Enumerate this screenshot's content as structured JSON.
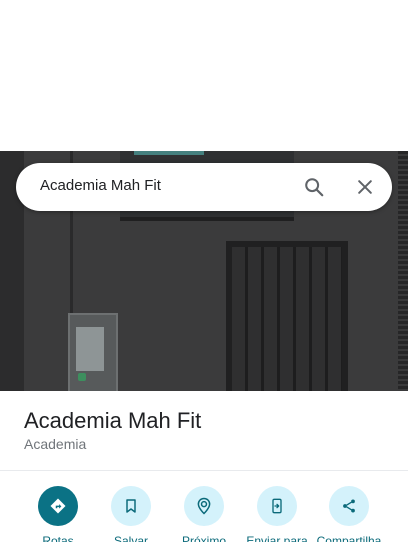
{
  "search": {
    "query": "Academia Mah Fit"
  },
  "place": {
    "name": "Academia Mah Fit",
    "category": "Academia"
  },
  "actions": [
    {
      "label": "Rotas",
      "icon": "directions-icon"
    },
    {
      "label": "Salvar",
      "icon": "bookmark-icon"
    },
    {
      "label": "Próximo",
      "icon": "nearby-icon"
    },
    {
      "label": "Enviar para",
      "icon": "send-to-phone-icon"
    },
    {
      "label": "Compartilha",
      "icon": "share-icon"
    }
  ],
  "colors": {
    "primary_action": "#0b7285",
    "action_bg": "#d4f2fb",
    "action_text": "#0b6a7a"
  }
}
